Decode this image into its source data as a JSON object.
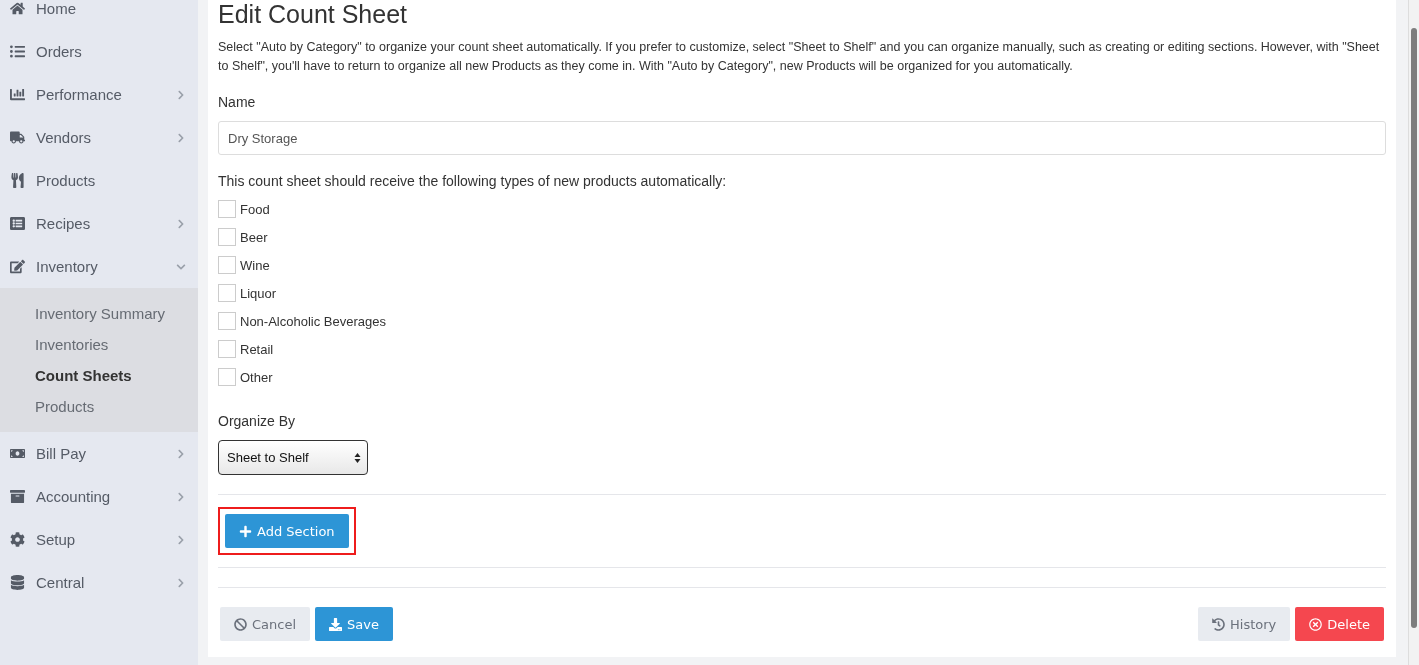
{
  "sidebar": {
    "items": [
      {
        "label": "Home",
        "kind": "link"
      },
      {
        "label": "Orders",
        "kind": "link"
      },
      {
        "label": "Performance",
        "kind": "group",
        "expanded": false
      },
      {
        "label": "Vendors",
        "kind": "group",
        "expanded": false
      },
      {
        "label": "Products",
        "kind": "link"
      },
      {
        "label": "Recipes",
        "kind": "group",
        "expanded": false
      },
      {
        "label": "Inventory",
        "kind": "group",
        "expanded": true,
        "children": [
          {
            "label": "Inventory Summary",
            "selected": false
          },
          {
            "label": "Inventories",
            "selected": false
          },
          {
            "label": "Count Sheets",
            "selected": true
          },
          {
            "label": "Products",
            "selected": false
          }
        ]
      },
      {
        "label": "Bill Pay",
        "kind": "group",
        "expanded": false
      },
      {
        "label": "Accounting",
        "kind": "group",
        "expanded": false
      },
      {
        "label": "Setup",
        "kind": "group",
        "expanded": false
      },
      {
        "label": "Central",
        "kind": "group",
        "expanded": false
      }
    ]
  },
  "page": {
    "title": "Edit Count Sheet",
    "intro": "Select \"Auto by Category\" to organize your count sheet automatically. If you prefer to customize, select \"Sheet to Shelf\" and you can organize manually, such as creating or editing sections. However, with \"Sheet to Shelf\", you'll have to return to organize all new Products as they come in. With \"Auto by Category\", new Products will be organized for you automatically.",
    "name_label": "Name",
    "name_value": "Dry Storage",
    "types_label": "This count sheet should receive the following types of new products automatically:",
    "types": [
      {
        "label": "Food",
        "checked": false
      },
      {
        "label": "Beer",
        "checked": false
      },
      {
        "label": "Wine",
        "checked": false
      },
      {
        "label": "Liquor",
        "checked": false
      },
      {
        "label": "Non-Alcoholic Beverages",
        "checked": false
      },
      {
        "label": "Retail",
        "checked": false
      },
      {
        "label": "Other",
        "checked": false
      }
    ],
    "organize_label": "Organize By",
    "organize_value": "Sheet to Shelf",
    "add_section": {
      "label": "Add Section",
      "highlighted": true
    },
    "buttons": [
      {
        "label": "Cancel",
        "kind": "cancel"
      },
      {
        "label": "Save",
        "kind": "save"
      },
      {
        "label": "History",
        "kind": "history"
      },
      {
        "label": "Delete",
        "kind": "delete"
      }
    ]
  }
}
